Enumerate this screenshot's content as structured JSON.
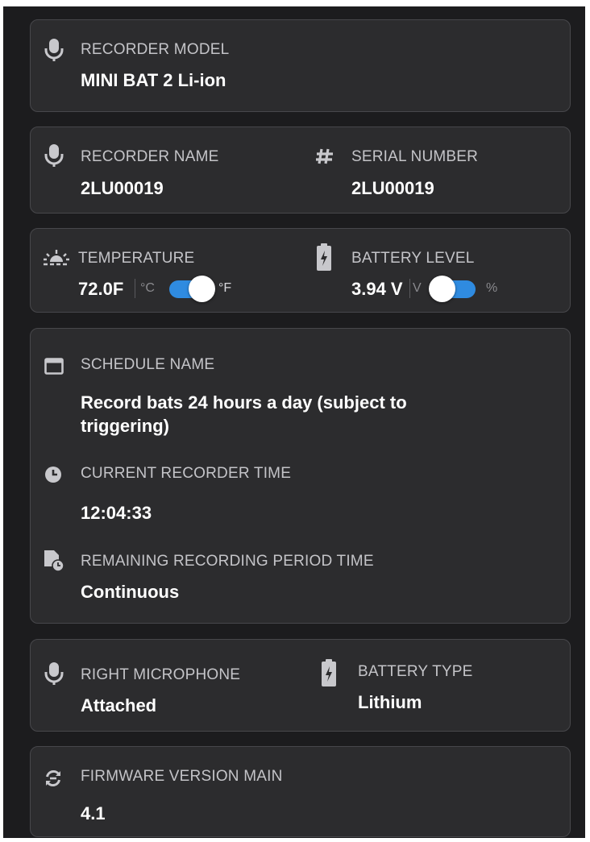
{
  "colors": {
    "panel_bg": "#1c1c1e",
    "card_bg": "#2c2c2e",
    "toggle_accent": "#2f8be0"
  },
  "recorder_model": {
    "icon": "microphone-icon",
    "label": "RECORDER MODEL",
    "value": "MINI BAT 2 Li-ion"
  },
  "recorder_name": {
    "icon": "microphone-icon",
    "label": "RECORDER NAME",
    "value": "2LU00019"
  },
  "serial_number": {
    "icon": "hashtag-icon",
    "label": "SERIAL NUMBER",
    "value": "2LU00019"
  },
  "temperature": {
    "icon": "sunrise-icon",
    "label": "TEMPERATURE",
    "value": "72.0F",
    "unit_left": "°C",
    "unit_right": "°F",
    "toggle_on": true
  },
  "battery_level": {
    "icon": "battery-charging-icon",
    "label": "BATTERY LEVEL",
    "value": "3.94 V",
    "unit_left": "V",
    "unit_right": "%",
    "toggle_on": false
  },
  "schedule": {
    "icon": "calendar-icon",
    "label": "SCHEDULE NAME",
    "value": "Record bats 24 hours a day (subject to triggering)"
  },
  "current_time": {
    "icon": "clock-icon",
    "label": "CURRENT RECORDER TIME",
    "value": "12:04:33"
  },
  "remaining_time": {
    "icon": "file-clock-icon",
    "label": "REMAINING RECORDING PERIOD TIME",
    "value": "Continuous"
  },
  "right_microphone": {
    "icon": "microphone-icon",
    "label": "RIGHT MICROPHONE",
    "value": "Attached"
  },
  "battery_type": {
    "icon": "battery-charging-icon",
    "label": "BATTERY TYPE",
    "value": "Lithium"
  },
  "firmware": {
    "icon": "sync-icon",
    "label": "FIRMWARE VERSION MAIN",
    "value": "4.1"
  }
}
